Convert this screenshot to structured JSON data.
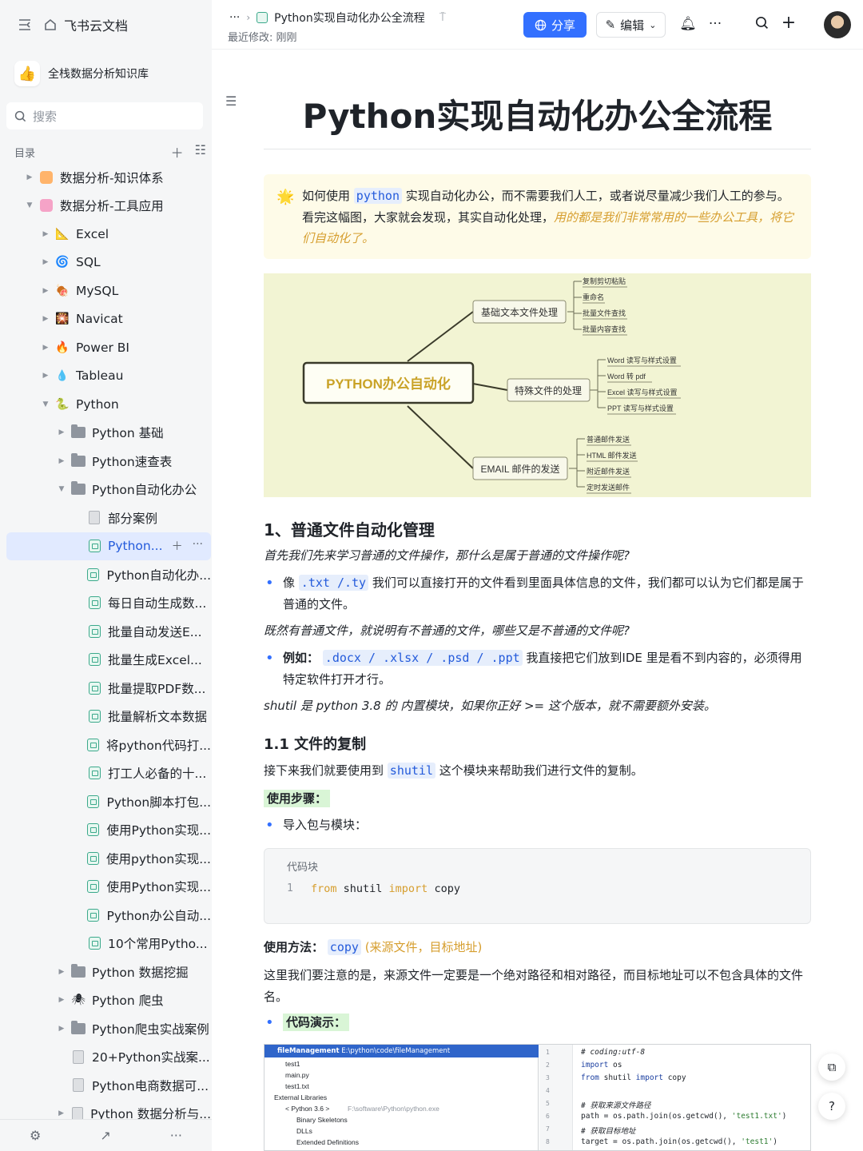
{
  "sidebar": {
    "app_title": "飞书云文档",
    "kb_name": "全栈数据分析知识库",
    "kb_icon": "thumbs-up-icon",
    "search_placeholder": "搜索",
    "toc_label": "目录",
    "tree": [
      {
        "label": "数据分析-知识体系",
        "depth": 0,
        "caret": "right",
        "icon": "orange-square-icon"
      },
      {
        "label": "数据分析-工具应用",
        "depth": 0,
        "caret": "down",
        "icon": "pink-square-icon"
      },
      {
        "label": "Excel",
        "depth": 1,
        "caret": "right",
        "icon": "excel-icon"
      },
      {
        "label": "SQL",
        "depth": 1,
        "caret": "right",
        "icon": "sql-icon"
      },
      {
        "label": "MySQL",
        "depth": 1,
        "caret": "right",
        "icon": "mysql-icon"
      },
      {
        "label": "Navicat",
        "depth": 1,
        "caret": "right",
        "icon": "navicat-icon"
      },
      {
        "label": "Power BI",
        "depth": 1,
        "caret": "right",
        "icon": "fire-icon"
      },
      {
        "label": "Tableau",
        "depth": 1,
        "caret": "right",
        "icon": "droplet-icon"
      },
      {
        "label": "Python",
        "depth": 1,
        "caret": "down",
        "icon": "python-icon"
      },
      {
        "label": "Python 基础",
        "depth": 2,
        "caret": "right",
        "icon": "folder-icon"
      },
      {
        "label": "Python速查表",
        "depth": 2,
        "caret": "right",
        "icon": "folder-icon"
      },
      {
        "label": "Python自动化办公",
        "depth": 2,
        "caret": "down",
        "icon": "folder-icon"
      },
      {
        "label": "部分案例",
        "depth": 3,
        "caret": "none",
        "icon": "page-icon"
      },
      {
        "label": "Python...",
        "depth": 3,
        "caret": "none",
        "icon": "doc-icon",
        "active": true
      },
      {
        "label": "Python自动化办...",
        "depth": 3,
        "caret": "none",
        "icon": "doc-icon"
      },
      {
        "label": "每日自动生成数...",
        "depth": 3,
        "caret": "none",
        "icon": "doc-icon"
      },
      {
        "label": "批量自动发送E...",
        "depth": 3,
        "caret": "none",
        "icon": "doc-icon"
      },
      {
        "label": "批量生成Excel...",
        "depth": 3,
        "caret": "none",
        "icon": "doc-icon"
      },
      {
        "label": "批量提取PDF数...",
        "depth": 3,
        "caret": "none",
        "icon": "doc-icon"
      },
      {
        "label": "批量解析文本数据",
        "depth": 3,
        "caret": "none",
        "icon": "doc-icon"
      },
      {
        "label": "将python代码打...",
        "depth": 3,
        "caret": "none",
        "icon": "doc-icon"
      },
      {
        "label": "打工人必备的十...",
        "depth": 3,
        "caret": "none",
        "icon": "doc-icon"
      },
      {
        "label": "Python脚本打包...",
        "depth": 3,
        "caret": "none",
        "icon": "doc-icon"
      },
      {
        "label": "使用Python实现...",
        "depth": 3,
        "caret": "none",
        "icon": "doc-icon"
      },
      {
        "label": "使用python实现...",
        "depth": 3,
        "caret": "none",
        "icon": "doc-icon"
      },
      {
        "label": "使用Python实现...",
        "depth": 3,
        "caret": "none",
        "icon": "doc-icon"
      },
      {
        "label": "Python办公自动...",
        "depth": 3,
        "caret": "none",
        "icon": "doc-icon"
      },
      {
        "label": "10个常用Pytho...",
        "depth": 3,
        "caret": "none",
        "icon": "doc-icon"
      },
      {
        "label": "Python 数据挖掘",
        "depth": 2,
        "caret": "right",
        "icon": "folder-icon"
      },
      {
        "label": "Python 爬虫",
        "depth": 2,
        "caret": "right",
        "icon": "spider-icon"
      },
      {
        "label": "Python爬虫实战案例",
        "depth": 2,
        "caret": "right",
        "icon": "folder-icon"
      },
      {
        "label": "20+Python实战案...",
        "depth": 2,
        "caret": "none",
        "icon": "page-icon"
      },
      {
        "label": "Python电商数据可...",
        "depth": 2,
        "caret": "none",
        "icon": "page-icon"
      },
      {
        "label": "Python 数据分析与...",
        "depth": 2,
        "caret": "right",
        "icon": "page-icon"
      }
    ]
  },
  "header": {
    "breadcrumb_ellipsis": "···",
    "breadcrumb_title": "Python实现自动化办公全流程",
    "last_modified": "最近修改: 刚刚",
    "share_label": "分享",
    "edit_label": "编辑"
  },
  "doc": {
    "title": "Python实现自动化办公全流程",
    "callout": {
      "p1": "如何使用",
      "code": "python",
      "p2": "实现自动化办公，而不需要我们人工，或者说尽量减少我们人工的参与。看完这幅图，大家就会发现，其实自动化处理，",
      "emph": "用的都是我们非常常用的一些办公工具，将它们自动化了。"
    },
    "mindmap": {
      "root": "PYTHON办公自动化",
      "branches": [
        {
          "label": "基础文本文件处理",
          "leaves": [
            "复制剪切粘贴",
            "重命名",
            "批量文件查找",
            "批量内容查找"
          ]
        },
        {
          "label": "特殊文件的处理",
          "leaves": [
            "Word 读写与样式设置",
            "Word 转 pdf",
            "Excel 读写与样式设置",
            "PPT 读写与样式设置"
          ]
        },
        {
          "label": "EMAIL 邮件的发送",
          "leaves": [
            "普通邮件发送",
            "HTML 邮件发送",
            "附近邮件发送",
            "定时发送邮件"
          ]
        }
      ]
    },
    "h1": "1、普通文件自动化管理",
    "q1": "首先我们先来学习普通的文件操作，那什么是属于普通的文件操作呢?",
    "b1_pre": "像",
    "b1_code": ".txt /.ty",
    "b1_post": "我们可以直接打开的文件看到里面具体信息的文件，我们都可以认为它们都是属于普通的文件。",
    "q2": "既然有普通文件，就说明有不普通的文件，哪些又是不普通的文件呢?",
    "b2_pre": "例如：",
    "b2_code": ".docx / .xlsx / .psd / .ppt",
    "b2_post": "我直接把它们放到IDE 里是看不到内容的，必须得用特定软件打开才行。",
    "note": "shutil 是 python 3.8 的 内置模块，如果你正好 >= 这个版本，就不需要额外安装。",
    "h2": "1.1 文件的复制",
    "p_shutil_pre": "接下来我们就要使用到",
    "p_shutil_code": "shutil",
    "p_shutil_post": "这个模块来帮助我们进行文件的复制。",
    "steps_label": "使用步骤：",
    "step1": "导入包与模块：",
    "codeblock_label": "代码块",
    "code_line_no": "1",
    "code_kw1": "from",
    "code_mod": " shutil ",
    "code_kw2": "import",
    "code_name": " copy",
    "usage_label": "使用方法：",
    "usage_code": "copy",
    "usage_args": "(来源文件，目标地址)",
    "p_note": "这里我们要注意的是，来源文件一定要是一个绝对路径和相对路径，而目标地址可以不包含具体的文件名。",
    "demo_label": "代码演示："
  },
  "ide": {
    "project": "fileManagement",
    "project_path": "E:\\python\\code\\fileManagement",
    "tree": [
      "test1",
      "main.py",
      "test1.txt",
      "External Libraries",
      "< Python 3.6 >",
      "F:\\software\\Python\\python.exe",
      "Binary Skeletons",
      "DLLs",
      "Extended Definitions"
    ],
    "line_numbers": [
      "1",
      "2",
      "3",
      "4",
      "5",
      "6",
      "7",
      "8"
    ],
    "code": {
      "l1": "# coding:utf-8",
      "l2_kw": "import",
      "l2_rest": " os",
      "l3_kw1": "from",
      "l3_mid": " shutil ",
      "l3_kw2": "import",
      "l3_rest": " copy",
      "l5": "# 获取来源文件路径",
      "l6_pre": "path = os.path.join(os.getcwd(), ",
      "l6_str": "'test1.txt'",
      "l6_post": ")",
      "l7": "# 获取目标地址",
      "l8_pre": "target = os.path.join(os.getcwd(), ",
      "l8_str": "'test1'",
      "l8_post": ")"
    }
  },
  "colors": {
    "accent": "#3370ff",
    "callout_bg": "#fefbe8",
    "mindmap_bg": "#f2f4d3",
    "emphasis_orange": "#d69e2e",
    "question_red": "#d25b2a"
  }
}
